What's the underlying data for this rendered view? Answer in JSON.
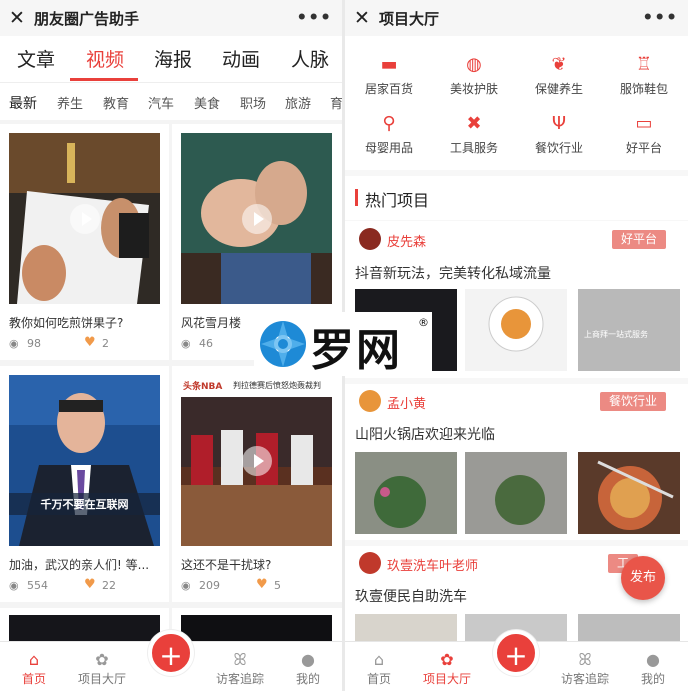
{
  "left": {
    "title": "朋友圈广告助手",
    "more": "•••",
    "close": "✕",
    "tabs": [
      "文章",
      "视频",
      "海报",
      "动画",
      "人脉"
    ],
    "categories": [
      "最新",
      "养生",
      "教育",
      "汽车",
      "美食",
      "职场",
      "旅游",
      "育"
    ],
    "videos": [
      {
        "caption": "教你如何吃煎饼果子?",
        "views": "98",
        "likes": "2"
      },
      {
        "caption": "风花雪月楼",
        "views": "46",
        "likes": ""
      },
      {
        "caption": "加油，武汉的亲人们! 等...",
        "views": "554",
        "likes": "22",
        "subtitle": "千万不要在互联网"
      },
      {
        "caption": "这还不是干扰球?",
        "views": "209",
        "likes": "5",
        "badge": "头条NBA",
        "headline": "判拉德赛后愤怒炮轰裁判"
      }
    ],
    "bottom": [
      "首页",
      "项目大厅",
      "访客追踪",
      "我的"
    ]
  },
  "right": {
    "title": "项目大厅",
    "more": "•••",
    "close": "✕",
    "categories": [
      "居家百货",
      "美妆护肤",
      "保健养生",
      "服饰鞋包",
      "母婴用品",
      "工具服务",
      "餐饮行业",
      "好平台"
    ],
    "hot_title": "热门项目",
    "projects": [
      {
        "name": "皮先森",
        "tag": "好平台",
        "desc": "抖音新玩法，完美转化私域流量",
        "img_text": "上商拜一站式服务"
      },
      {
        "name": "孟小黄",
        "tag": "餐饮行业",
        "desc": "山阳火锅店欢迎来光临"
      },
      {
        "name": "玖壹洗车叶老师",
        "tag": "工",
        "desc": "玖壹便民自助洗车"
      }
    ],
    "fab": "发布",
    "bottom": [
      "首页",
      "项目大厅",
      "访客追踪",
      "我的"
    ]
  },
  "plus": "+",
  "watermark": {
    "text": "罗网",
    "reg": "®"
  },
  "colors": {
    "accent": "#e9403b",
    "tag": "#ec8a83",
    "heart": "#f19a4a"
  }
}
